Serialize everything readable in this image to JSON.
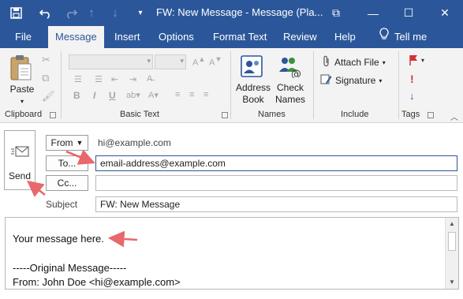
{
  "window": {
    "title": "FW: New Message  -  Message (Pla...",
    "restore_glyph": "⧉",
    "minimize_glyph": "—",
    "maximize_glyph": "☐",
    "close_glyph": "✕"
  },
  "qat": {
    "save_icon": "save-icon",
    "undo_icon": "undo-icon",
    "redo_icon": "redo-icon",
    "up_icon": "up-arrow-icon",
    "down_icon": "down-arrow-icon",
    "customize_icon": "customize-icon"
  },
  "tabs": [
    {
      "label": "File"
    },
    {
      "label": "Message"
    },
    {
      "label": "Insert"
    },
    {
      "label": "Options"
    },
    {
      "label": "Format Text"
    },
    {
      "label": "Review"
    },
    {
      "label": "Help"
    },
    {
      "label": "Tell me"
    }
  ],
  "ribbon": {
    "clipboard": {
      "paste": "Paste",
      "group": "Clipboard"
    },
    "basic_text": {
      "group": "Basic Text",
      "bold": "B",
      "italic": "I",
      "underline": "U"
    },
    "names": {
      "address_book_1": "Address",
      "address_book_2": "Book",
      "check_names_1": "Check",
      "check_names_2": "Names",
      "group": "Names"
    },
    "include": {
      "attach_file": "Attach File",
      "signature": "Signature",
      "group": "Include"
    },
    "tags": {
      "group": "Tags"
    }
  },
  "header": {
    "send_label": "Send",
    "from_button": "From",
    "from_address": "hi@example.com",
    "to_button": "To...",
    "to_value": "email-address@example.com",
    "cc_button": "Cc...",
    "cc_value": "",
    "subject_label": "Subject",
    "subject_value": "FW: New Message"
  },
  "body": {
    "line1": "Your message here.",
    "line2": "-----Original Message-----",
    "line3": "From: John Doe <hi@example.com>"
  },
  "colors": {
    "accent": "#2b579a",
    "annotation_arrow": "#e8686c"
  }
}
